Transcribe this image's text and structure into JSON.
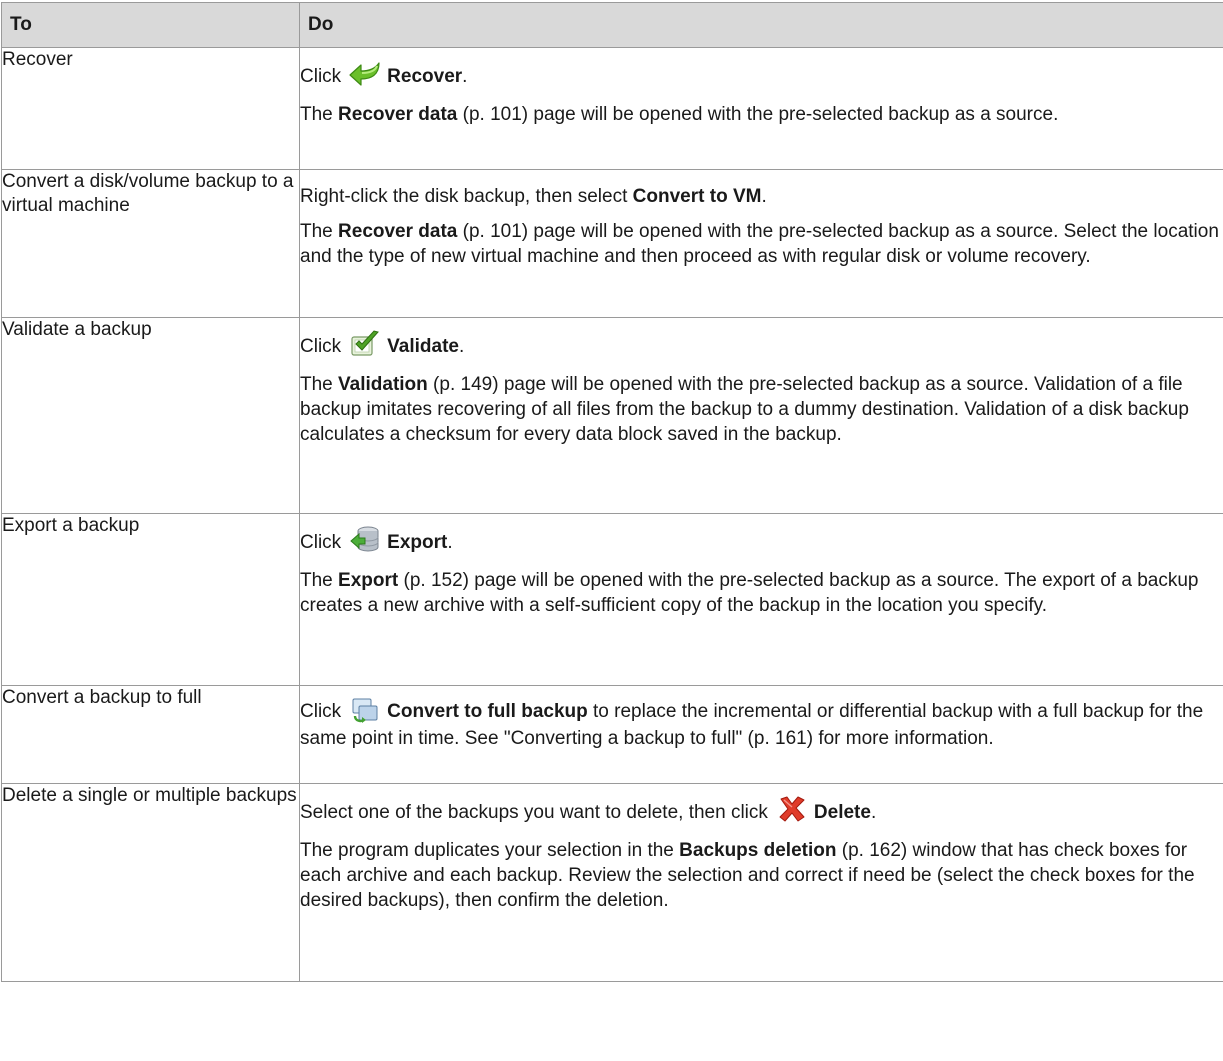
{
  "header": {
    "col_to": "To",
    "col_do": "Do"
  },
  "rows": [
    {
      "to": "Recover",
      "do_first": {
        "pre": "Click",
        "icon": "recover-arrow-icon",
        "bold": "Recover",
        "post": "."
      },
      "do_second": {
        "pre": "The ",
        "bold": "Recover data",
        "post": " (p. 101) page will be opened with the pre-selected backup as a source."
      }
    },
    {
      "to": "Convert a disk/volume backup to a virtual machine",
      "do_first": {
        "pre": "Right-click the disk backup, then select ",
        "bold": "Convert to VM",
        "post": "."
      },
      "do_second": {
        "pre": "The ",
        "bold": "Recover data",
        "post": " (p. 101) page will be opened with the pre-selected backup as a source. Select the location and the type of new virtual machine and then proceed as with regular disk or volume recovery."
      }
    },
    {
      "to": "Validate a backup",
      "do_first": {
        "pre": "Click",
        "icon": "validate-check-icon",
        "bold": "Validate",
        "post": "."
      },
      "do_second": {
        "pre": "The ",
        "bold": "Validation",
        "post": " (p. 149) page will be opened with the pre-selected backup as a source. Validation of a file backup imitates recovering of all files from the backup to a dummy destination. Validation of a disk backup calculates a checksum for every data block saved in the backup."
      }
    },
    {
      "to": "Export a backup",
      "do_first": {
        "pre": "Click",
        "icon": "export-database-icon",
        "bold": "Export",
        "post": "."
      },
      "do_second": {
        "pre": "The ",
        "bold": "Export",
        "post": " (p. 152) page will be opened with the pre-selected backup as a source. The export of a backup creates a new archive with a self-sufficient copy of the backup in the location you specify."
      }
    },
    {
      "to": "Convert a backup to full",
      "do_first": {
        "pre": "Click",
        "icon": "convert-full-icon",
        "bold": "Convert to full backup",
        "post": " to replace the incremental or differential backup with a full backup for the same point in time. See \"Converting a backup to full\" (p. 161) for more information."
      }
    },
    {
      "to": "Delete a single or multiple backups",
      "do_first": {
        "pre": "Select one of the backups you want to delete, then click",
        "icon": "delete-x-icon",
        "bold": "Delete",
        "post": "."
      },
      "do_second": {
        "pre": "The program duplicates your selection in the ",
        "bold": "Backups deletion",
        "post": " (p. 162) window that has check boxes for each archive and each backup. Review the selection and correct if need be (select the check boxes for the desired backups), then confirm the deletion."
      }
    }
  ],
  "colors": {
    "header_bg": "#d9d9d9",
    "border": "#9a9a9a",
    "recover_green": "#6abf2a",
    "delete_red": "#e03c2a"
  }
}
